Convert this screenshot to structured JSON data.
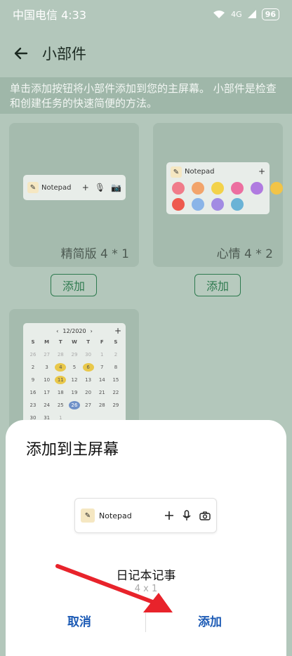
{
  "status": {
    "carrier_time": "中国电信 4:33",
    "signal": "4G",
    "battery": "96"
  },
  "app_bar": {
    "title": "小部件"
  },
  "banner": {
    "text": "单击添加按钮将小部件添加到您的主屏幕。 小部件是检查和创建任务的快速简便的方法。"
  },
  "widgets": [
    {
      "label": "精简版 4 * 1",
      "add": "添加",
      "app_name": "Notepad"
    },
    {
      "label": "心情 4 * 2",
      "add": "添加",
      "app_name": "Notepad"
    },
    {
      "month": "12/2020"
    }
  ],
  "calendar": {
    "weekdays": [
      "S",
      "M",
      "T",
      "W",
      "T",
      "F",
      "S"
    ],
    "rows": [
      [
        "26",
        "27",
        "28",
        "29",
        "30",
        "1",
        "2"
      ],
      [
        "2",
        "3",
        "4",
        "5",
        "6",
        "7",
        "8"
      ],
      [
        "9",
        "10",
        "11",
        "12",
        "13",
        "14",
        "15"
      ],
      [
        "16",
        "17",
        "18",
        "19",
        "20",
        "21",
        "22"
      ],
      [
        "23",
        "24",
        "25",
        "26",
        "27",
        "28",
        "29"
      ],
      [
        "30",
        "31",
        "1",
        "",
        "",
        "",
        ""
      ]
    ]
  },
  "sheet": {
    "title": "添加到主屏幕",
    "preview_name": "Notepad",
    "widget_name": "日记本记事",
    "widget_size": "4 x 1",
    "cancel": "取消",
    "add": "添加"
  },
  "colors": {
    "accent_green": "#2e7a4f",
    "action_blue": "#1d5bb5",
    "arrow_red": "#e8232b"
  }
}
